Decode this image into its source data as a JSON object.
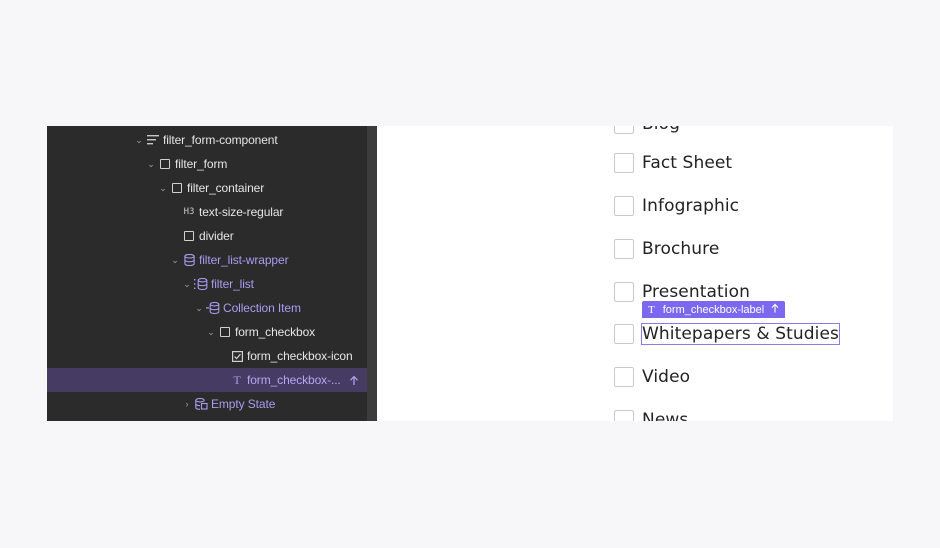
{
  "navigator": {
    "items": [
      {
        "label": "filter_form-component",
        "icon": "component-lines-icon",
        "expanded": true
      },
      {
        "label": "filter_form",
        "icon": "box-icon",
        "expanded": true
      },
      {
        "label": "filter_container",
        "icon": "box-icon",
        "expanded": true
      },
      {
        "label": "text-size-regular",
        "icon": "heading-h3-icon",
        "icon_text": "H3"
      },
      {
        "label": "divider",
        "icon": "box-icon"
      },
      {
        "label": "filter_list-wrapper",
        "icon": "database-icon",
        "expanded": true
      },
      {
        "label": "filter_list",
        "icon": "collection-list-icon",
        "expanded": true
      },
      {
        "label": "Collection Item",
        "icon": "collection-item-icon",
        "expanded": true
      },
      {
        "label": "form_checkbox",
        "icon": "box-icon",
        "expanded": true
      },
      {
        "label": "form_checkbox-icon",
        "icon": "checkbox-checked-icon"
      },
      {
        "label": "form_checkbox-...",
        "icon": "text-t-icon",
        "icon_text": "T",
        "selected": true
      },
      {
        "label": "Empty State",
        "icon": "empty-state-icon",
        "expanded": false
      }
    ]
  },
  "canvas": {
    "checkbox_items": [
      "Blog",
      "Fact Sheet",
      "Infographic",
      "Brochure",
      "Presentation",
      "Whitepapers & Studies",
      "Video",
      "News"
    ],
    "selected_index": 5,
    "element_tag": {
      "icon_text": "T",
      "label": "form_checkbox-label"
    }
  },
  "colors": {
    "navigator_bg": "#2b2b2b",
    "selection_bg": "#463c63",
    "accent_purple": "#7c68ee",
    "purple_text": "#a99cf0"
  }
}
